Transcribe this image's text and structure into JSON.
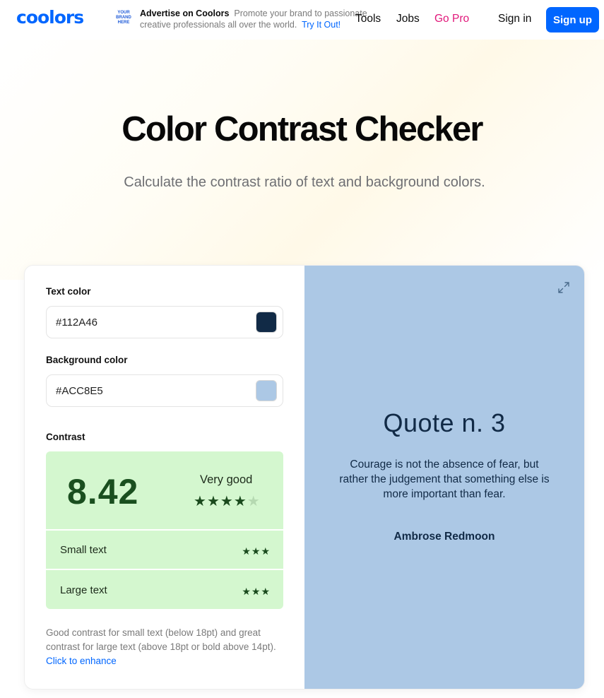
{
  "header": {
    "logo": "coolors",
    "ad": {
      "badge_text": "YOUR BRAND HERE",
      "title": "Advertise on Coolors",
      "description": "Promote your brand to passionate creative professionals all over the world.",
      "cta": "Try It Out!"
    },
    "nav": {
      "tools": "Tools",
      "jobs": "Jobs",
      "go_pro": "Go Pro",
      "sign_in": "Sign in",
      "sign_up": "Sign up"
    }
  },
  "hero": {
    "title": "Color Contrast Checker",
    "subtitle": "Calculate the contrast ratio of text and background colors."
  },
  "checker": {
    "text_color_label": "Text color",
    "text_color_value": "#112A46",
    "background_color_label": "Background color",
    "background_color_value": "#ACC8E5",
    "contrast_label": "Contrast",
    "ratio": "8.42",
    "rating": "Very good",
    "rating_stars": 4,
    "rating_stars_max": 5,
    "small_text_label": "Small text",
    "small_text_stars": 3,
    "large_text_label": "Large text",
    "large_text_stars": 3,
    "note": "Good contrast for small text (below 18pt) and great contrast for large text (above 18pt or bold above 14pt).",
    "note_link": "Click to enhance"
  },
  "preview": {
    "quote_title": "Quote n. 3",
    "quote_body": "Courage is not the absence of fear, but rather the judgement that something else is more important than fear.",
    "quote_author": "Ambrose Redmoon",
    "expand_icon": "expand-icon"
  },
  "colors": {
    "brand": "#0066ff",
    "go_pro": "#e1177a",
    "text_color": "#112a46",
    "background_color": "#acc8e5",
    "contrast_good_bg": "#d4f7cf"
  }
}
